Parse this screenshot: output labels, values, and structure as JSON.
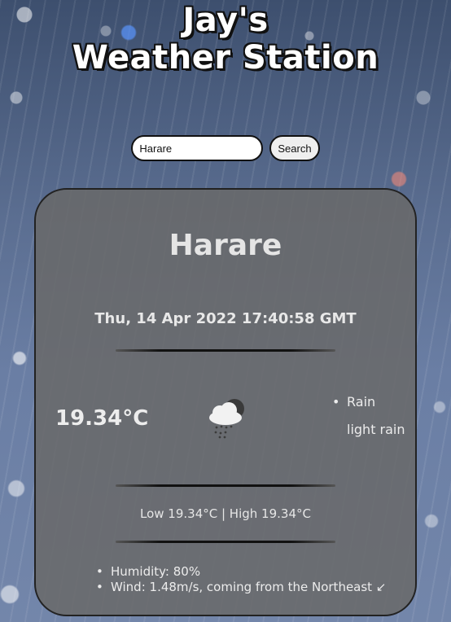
{
  "header": {
    "title_line1": "Jay's",
    "title_line2": "Weather Station"
  },
  "search": {
    "value": "Harare",
    "placeholder": "",
    "button_label": "Search"
  },
  "weather": {
    "city": "Harare",
    "datetime": "Thu, 14 Apr 2022 17:40:58 GMT",
    "temperature": "19.34°C",
    "icon": "cloud-rain-icon",
    "condition_main": "Rain",
    "condition_desc": "light rain",
    "low_high": "Low 19.34°C | High 19.34°C",
    "humidity": "Humidity: 80%",
    "wind": "Wind: 1.48m/s, coming from the Northeast ↙"
  },
  "colors": {
    "card_bg": "#696969",
    "text": "#e7e7e7",
    "title_fill": "#ffffff",
    "title_outline": "#111111"
  }
}
